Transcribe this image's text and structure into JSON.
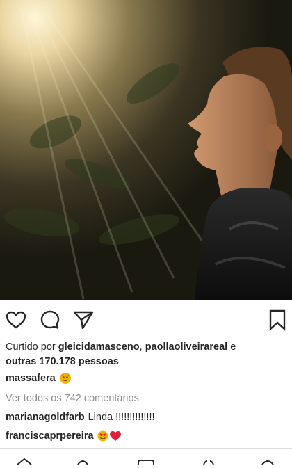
{
  "post": {
    "photo_icon": "post-photo"
  },
  "actions": {
    "like_icon": "heart-outline-icon",
    "comment_icon": "comment-bubble-icon",
    "share_icon": "paper-plane-icon",
    "save_icon": "bookmark-icon"
  },
  "likes": {
    "prefix": "Curtido por ",
    "user1": "gleicidamasceno",
    "sep": ", ",
    "user2": "paollaoliveirareal",
    "and": " e",
    "others": "outras 170.178 pessoas"
  },
  "caption": {
    "username": "massafera",
    "emoji": "emoji-icon"
  },
  "view_all_comments": "Ver todos os 742 comentários",
  "comments": [
    {
      "username": "marianagoldfarb",
      "text": "Linda !!!!!!!!!!!!!!"
    },
    {
      "username": "franciscaprpereira",
      "emoji": [
        "heart-eyes-emoji",
        "red-heart-emoji"
      ]
    }
  ],
  "colors": {
    "text": "#262626",
    "muted": "#8e8e8e",
    "heart": "#e0213b",
    "emoji_yellow": "#f5b400",
    "divider": "#dbdbdb"
  }
}
